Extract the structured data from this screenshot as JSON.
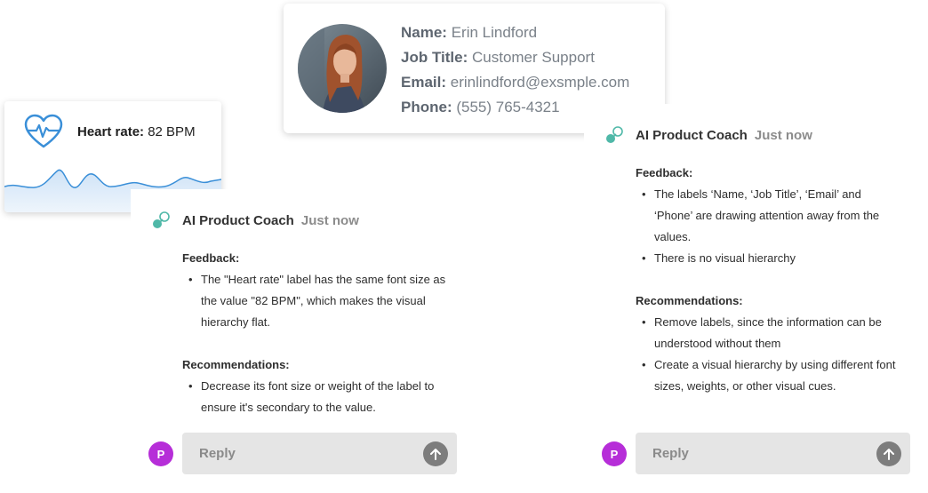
{
  "profile": {
    "name_label": "Name:",
    "name_value": "Erin Lindford",
    "title_label": "Job Title:",
    "title_value": "Customer Support",
    "email_label": "Email:",
    "email_value": "erinlindford@exsmple.com",
    "phone_label": "Phone:",
    "phone_value": "(555) 765-4321",
    "avatar_icon": "user-photo"
  },
  "heart": {
    "label": "Heart rate:",
    "value": "82 BPM",
    "icon": "heart-pulse-icon",
    "accent": "#3a8fd8"
  },
  "coach_left": {
    "name": "AI Product Coach",
    "time": "Just now",
    "feedback_title": "Feedback:",
    "feedback": [
      "The \"Heart rate\" label has the same font size as the value \"82 BPM\", which makes the visual hierarchy flat."
    ],
    "recommendations_title": "Recommendations:",
    "recommendations": [
      "Decrease its font size or weight of the label to ensure it's secondary to the value."
    ],
    "user_initial": "P",
    "reply_placeholder": "Reply"
  },
  "coach_right": {
    "name": "AI Product Coach",
    "time": "Just now",
    "feedback_title": "Feedback:",
    "feedback": [
      "The labels ‘Name, ‘Job Title’, ‘Email’ and ‘Phone’ are drawing attention away from the values.",
      "There is no visual hierarchy"
    ],
    "recommendations_title": "Recommendations:",
    "recommendations": [
      "Remove labels, since the information can be understood without them",
      "Create a visual hierarchy by using different font sizes, weights, or other visual cues."
    ],
    "user_initial": "P",
    "reply_placeholder": "Reply"
  },
  "colors": {
    "user_avatar": "#b62ed8",
    "coach_logo": "#4fb8a8",
    "reply_bg": "#e5e5e5"
  }
}
